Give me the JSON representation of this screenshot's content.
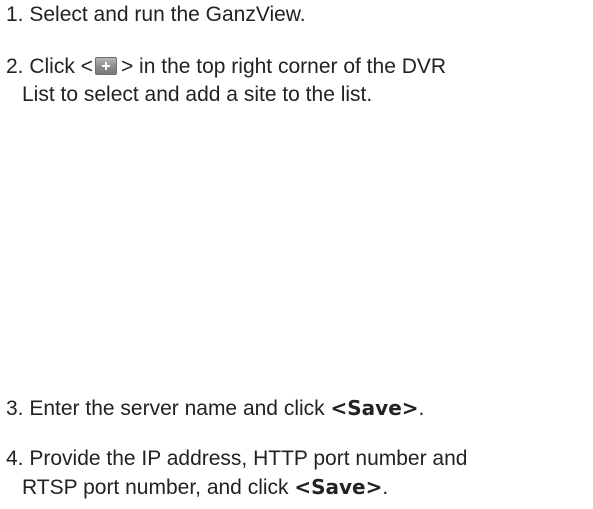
{
  "steps": {
    "step1": {
      "text": "1. Select and run the GanzView."
    },
    "step2": {
      "line1_before": "2. Click <",
      "line1_after": "> in the top right corner of the DVR",
      "line2": "List  to select and add a site to the list.",
      "button_icon": "plus-icon"
    },
    "step3": {
      "before": "3. Enter the server name and click ",
      "bold": "<Save>",
      "after": "."
    },
    "step4": {
      "line1": "4. Provide the IP address, HTTP port number and",
      "line2_before": "RTSP port number, and click ",
      "bold": "<Save>",
      "after": "."
    }
  }
}
